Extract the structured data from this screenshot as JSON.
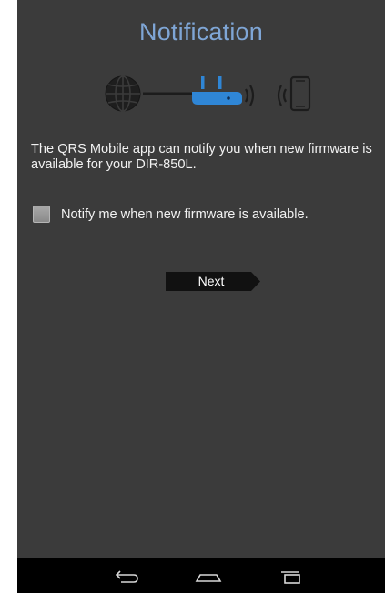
{
  "header": {
    "title": "Notification"
  },
  "diagram": {
    "icons": [
      "globe-icon",
      "router-icon",
      "signal-waves-icon",
      "phone-icon"
    ],
    "colors": {
      "globe": "#1c1c1c",
      "router": "#2f86d6",
      "phone": "#1c1c1c"
    }
  },
  "content": {
    "intro_text": "The QRS Mobile app can notify you when new firmware is available for your DIR-850L.",
    "notify_checkbox": {
      "label": "Notify me when new firmware is available.",
      "checked": false
    },
    "next_button_label": "Next"
  },
  "navigation_bar": {
    "buttons": [
      "back-icon",
      "home-icon",
      "recent-apps-icon"
    ]
  },
  "colors": {
    "title": "#7fa6d6",
    "background": "#3b3b3b",
    "navbar": "#000000"
  }
}
